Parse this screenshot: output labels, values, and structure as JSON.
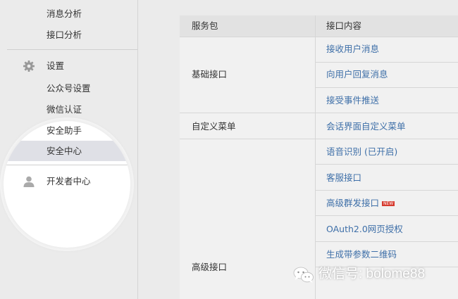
{
  "sidebar": {
    "analysis_items": [
      "消息分析",
      "接口分析"
    ],
    "settings": {
      "label": "设置",
      "icon": "gear-icon"
    },
    "settings_items": [
      "公众号设置",
      "微信认证",
      "安全助手",
      "安全中心"
    ],
    "active_item": "安全中心",
    "developer": {
      "label": "开发者中心",
      "icon": "user-icon"
    }
  },
  "table": {
    "headers": {
      "package": "服务包",
      "content": "接口内容"
    },
    "groups": [
      {
        "name": "基础接口",
        "apis": [
          "接收用户消息",
          "向用户回复消息",
          "接受事件推送"
        ]
      },
      {
        "name": "自定义菜单",
        "apis": [
          "会话界面自定义菜单"
        ]
      },
      {
        "name": "高级接口",
        "apis": [
          "语音识别 (已开启)",
          "客服接口",
          "高级群发接口",
          "OAuth2.0网页授权",
          "生成带参数二维码"
        ]
      }
    ],
    "new_badge": "NEW"
  },
  "watermark": {
    "text": "微信号: bolome88",
    "icon": "wechat-icon"
  },
  "colors": {
    "link": "#3e6fa8",
    "badge": "#d63b2f",
    "background": "#ebebeb"
  }
}
